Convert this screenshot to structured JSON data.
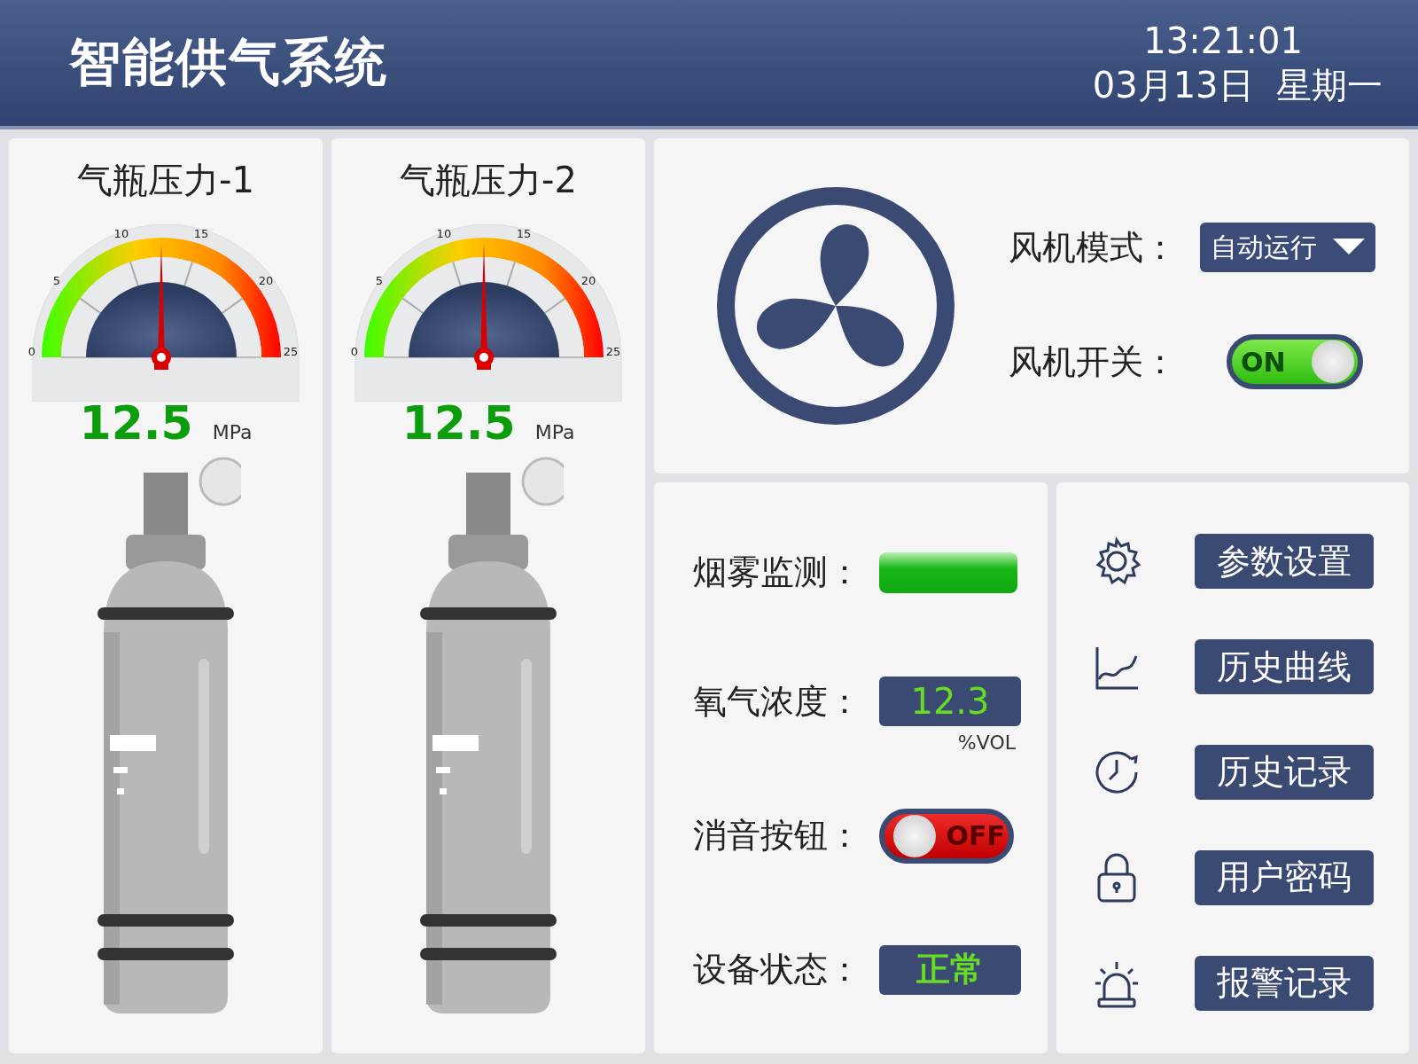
{
  "header": {
    "title": "智能供气系统",
    "time": "13:21:01",
    "date": "03月13日  星期一"
  },
  "cylinders": [
    {
      "title": "气瓶压力-1",
      "ticks": [
        "0",
        "5",
        "10",
        "15",
        "20",
        "25"
      ],
      "level": 0.5,
      "value": "12.5",
      "unit": "MPa"
    },
    {
      "title": "气瓶压力-2",
      "ticks": [
        "0",
        "5",
        "10",
        "15",
        "20",
        "25"
      ],
      "level": 0.5,
      "value": "12.5",
      "unit": "MPa"
    }
  ],
  "fan": {
    "mode_label": "风机模式：",
    "mode": "自动运行",
    "switch_label": "风机开关：",
    "switch_on": true,
    "switch_text": "ON"
  },
  "status": [
    {
      "kind": "indicator",
      "label": "烟雾监测：",
      "on": true
    },
    {
      "kind": "reading",
      "label": "氧气浓度：",
      "value": "12.3",
      "unit": "%VOL"
    },
    {
      "kind": "toggle",
      "label": "消音按钮：",
      "on": false,
      "text": "OFF"
    },
    {
      "kind": "badge",
      "label": "设备状态：",
      "value": "正常"
    }
  ],
  "menu": [
    {
      "kind": "gear",
      "label": "参数设置"
    },
    {
      "kind": "chart",
      "label": "历史曲线"
    },
    {
      "kind": "clock",
      "label": "历史记录"
    },
    {
      "kind": "lock",
      "label": "用户密码"
    },
    {
      "kind": "alarm",
      "label": "报警记录"
    }
  ]
}
